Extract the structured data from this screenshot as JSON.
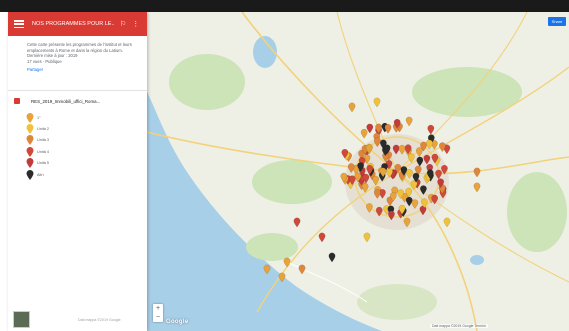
{
  "sidebar": {
    "title": "NOS PROGRAMMES POUR LE...",
    "description": "Cette carte présente les programmes de l'institut et leurs emplacements à Rome et dans la région du Latium. Dernière mise à jour : 2019",
    "views_text": "17 vues · Publique",
    "link_label": "Partager",
    "layer_title": "RES_2019_Immobili_uffici_Roma...",
    "legend": [
      {
        "label": "1°",
        "color": "#e8a33a"
      },
      {
        "label": "Unità 2",
        "color": "#f0c23b"
      },
      {
        "label": "Unità 3",
        "color": "#e0863a"
      },
      {
        "label": "Unità 4",
        "color": "#d0483a"
      },
      {
        "label": "Unità 5",
        "color": "#c23b3b"
      },
      {
        "label": "Altri",
        "color": "#2b2b2b"
      }
    ],
    "footer_text": "Dati mappa ©2019 Google"
  },
  "header_icons": {
    "share": "share-icon",
    "more": "more-vert-icon"
  },
  "map": {
    "share_button_label": "Share",
    "zoom_in_label": "+",
    "zoom_out_label": "−",
    "logo_text": "Google",
    "attribution_text": "Dati mappa ©2019 Google  Termini"
  },
  "colors": {
    "brand_red": "#d93b34",
    "water": "#a8cfe8",
    "park": "#cde3b8",
    "road": "#f2d27a"
  }
}
